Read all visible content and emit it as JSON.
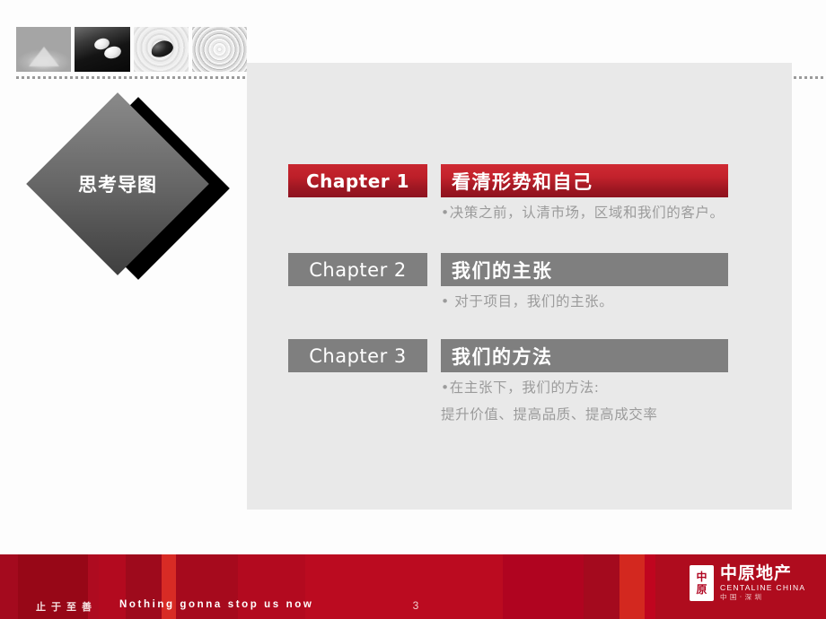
{
  "slide": {
    "page_number": "3",
    "diamond_title": "思考导图",
    "accent_red": "#bd1f29",
    "accent_grey": "#7f7f7f",
    "panel_bg": "#e9e9e9",
    "footer_bg": "#b00420",
    "body_text_color": "#9b9b9b"
  },
  "photo_strip": {
    "thumbs": [
      {
        "name": "sand-cone-photo",
        "alt": "沙堆"
      },
      {
        "name": "white-stones-photo",
        "alt": "白石"
      },
      {
        "name": "black-pebble-photo",
        "alt": "黑石"
      },
      {
        "name": "water-ripple-photo",
        "alt": "水纹"
      }
    ]
  },
  "chapters": [
    {
      "tag": "Chapter 1",
      "title": "看清形势和自己",
      "lines": [
        "•决策之前，认清市场，区域和我们的客户。"
      ],
      "color": "red"
    },
    {
      "tag": "Chapter 2",
      "title": "我们的主张",
      "lines": [
        "• 对于项目，我们的主张。"
      ],
      "color": "grey"
    },
    {
      "tag": "Chapter 3",
      "title": "我们的方法",
      "lines": [
        "•在主张下，我们的方法:",
        "提升价值、提高品质、提高成交率"
      ],
      "color": "grey"
    }
  ],
  "footer": {
    "slogan_cn": "止于至善",
    "slogan_en": "Nothing gonna stop us now",
    "page_number": "3"
  },
  "logo": {
    "mark_top": "中",
    "mark_bottom": "原",
    "name_cn": "中原地产",
    "name_en": "CENTALINE CHINA",
    "sub": "中国·深圳"
  }
}
